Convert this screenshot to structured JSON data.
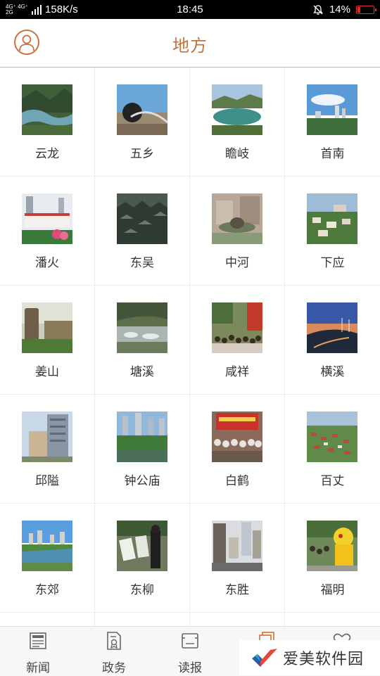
{
  "status": {
    "network_top": "4G⁺ 4G⁺",
    "network_bottom": "2G",
    "speed": "158K/s",
    "time": "18:45",
    "battery_pct": "14%",
    "battery_level": 0.14
  },
  "header": {
    "title": "地方"
  },
  "grid": {
    "items": [
      {
        "label": "云龙",
        "thumb": "mountain-lake-photo"
      },
      {
        "label": "五乡",
        "thumb": "bridge-sphere-photo"
      },
      {
        "label": "瞻岐",
        "thumb": "reservoir-photo"
      },
      {
        "label": "首南",
        "thumb": "city-skyline-photo"
      },
      {
        "label": "潘火",
        "thumb": "street-towers-photo"
      },
      {
        "label": "东吴",
        "thumb": "village-roofs-photo"
      },
      {
        "label": "中河",
        "thumb": "plaza-statue-photo"
      },
      {
        "label": "下应",
        "thumb": "suburb-houses-photo"
      },
      {
        "label": "姜山",
        "thumb": "stone-monument-photo"
      },
      {
        "label": "塘溪",
        "thumb": "stream-rocks-photo"
      },
      {
        "label": "咸祥",
        "thumb": "crowd-festival-photo"
      },
      {
        "label": "横溪",
        "thumb": "wind-turbine-dusk-photo"
      },
      {
        "label": "邱隘",
        "thumb": "office-building-photo"
      },
      {
        "label": "钟公庙",
        "thumb": "park-towers-photo"
      },
      {
        "label": "白鹤",
        "thumb": "stage-crowd-photo"
      },
      {
        "label": "百丈",
        "thumb": "aerial-town-photo"
      },
      {
        "label": "东郊",
        "thumb": "river-city-photo"
      },
      {
        "label": "东柳",
        "thumb": "exhibition-boards-photo"
      },
      {
        "label": "东胜",
        "thumb": "downtown-street-photo"
      },
      {
        "label": "福明",
        "thumb": "lion-dance-photo"
      }
    ]
  },
  "tabbar": {
    "tabs": [
      {
        "label": "新闻",
        "icon": "newspaper-icon"
      },
      {
        "label": "政务",
        "icon": "document-badge-icon"
      },
      {
        "label": "读报",
        "icon": "open-paper-icon"
      },
      {
        "label": "",
        "icon": "stack-icon",
        "active": true
      },
      {
        "label": "",
        "icon": "heart-icon"
      }
    ]
  },
  "watermark": {
    "text": "爱美软件园",
    "icon": "check-logo"
  },
  "colors": {
    "accent": "#c8713a",
    "divider": "#ececec",
    "statusbar": "#000000"
  }
}
